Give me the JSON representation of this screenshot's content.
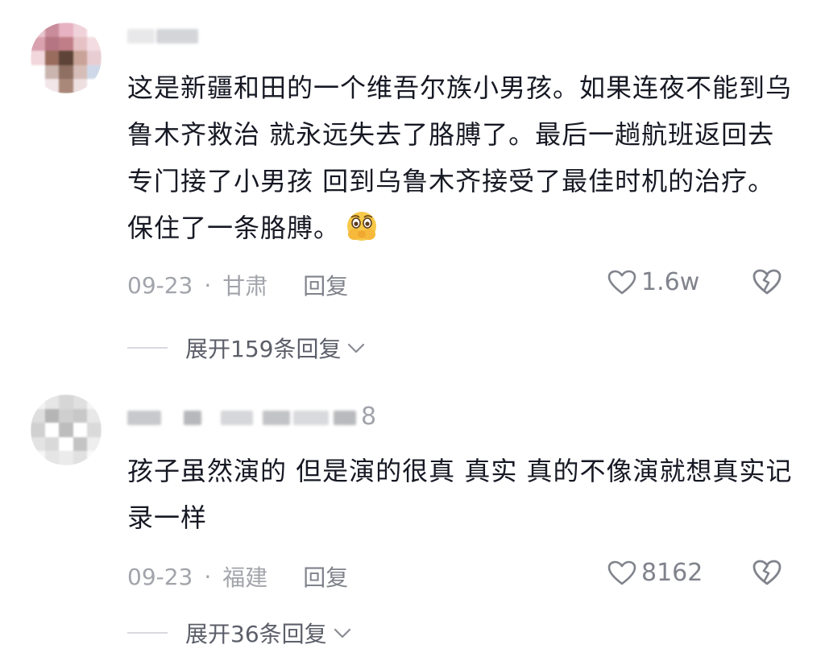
{
  "comments": [
    {
      "text": "这是新疆和田的一个维吾尔族小男孩。如果连夜不能到乌鲁木齐救治 就永远失去了胳膊了。最后一趟航班返回去专门接了小男孩 回到乌鲁木齐接受了最佳时机的治疗。保住了一条胳膊。",
      "emoji": "face-holding-back-tears",
      "date": "09-23",
      "separator": "·",
      "location": "甘肃",
      "reply_label": "回复",
      "likes": "1.6w",
      "expand_label": "展开159条回复"
    },
    {
      "text": "孩子虽然演的 但是演的很真 真实 真的不像演就想真实记录一样",
      "username_suffix": "8",
      "date": "09-23",
      "separator": "·",
      "location": "福建",
      "reply_label": "回复",
      "likes": "8162",
      "expand_label": "展开36条回复"
    }
  ],
  "icons": {
    "like": "heart-outline-icon",
    "dislike": "broken-heart-icon",
    "expand": "chevron-down-icon"
  },
  "colors": {
    "text": "#161823",
    "meta": "#a2a4ab",
    "expand": "#5c5f69"
  }
}
